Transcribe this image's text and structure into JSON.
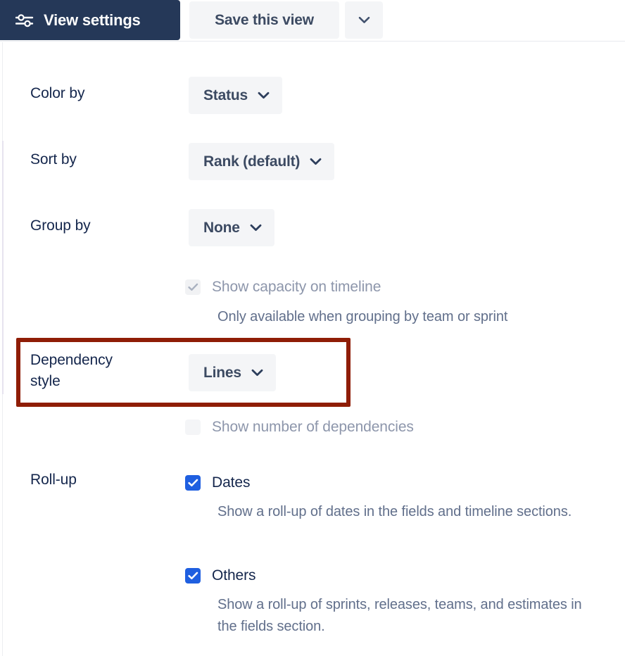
{
  "toolbar": {
    "view_settings_label": "View settings",
    "view_settings_icon": "sliders-icon",
    "save_view_label": "Save this view",
    "save_view_caret_icon": "chevron-down-icon",
    "accent_color": "#253858",
    "button_bg": "#f4f5f7"
  },
  "settings": {
    "color_by": {
      "label": "Color by",
      "value": "Status",
      "caret_icon": "chevron-down-icon"
    },
    "sort_by": {
      "label": "Sort by",
      "value": "Rank (default)",
      "caret_icon": "chevron-down-icon"
    },
    "group_by": {
      "label": "Group by",
      "value": "None",
      "caret_icon": "chevron-down-icon"
    },
    "show_capacity": {
      "label": "Show capacity on timeline",
      "help": "Only available when grouping by team or sprint",
      "checked": true,
      "disabled": true
    },
    "dependency_style": {
      "label": "Dependency\nstyle",
      "value": "Lines",
      "caret_icon": "chevron-down-icon",
      "highlighted": true,
      "highlight_color": "#8f1d06"
    },
    "show_number_of_dependencies": {
      "label": "Show number of dependencies",
      "checked": false,
      "disabled": true
    },
    "rollup": {
      "label": "Roll-up",
      "options": [
        {
          "label": "Dates",
          "help": "Show a roll-up of dates in the fields and timeline sections.",
          "checked": true
        },
        {
          "label": "Others",
          "help": "Show a roll-up of sprints, releases, teams, and estimates in the fields section.",
          "checked": true
        }
      ],
      "checkbox_color": "#1f5fe0"
    }
  }
}
